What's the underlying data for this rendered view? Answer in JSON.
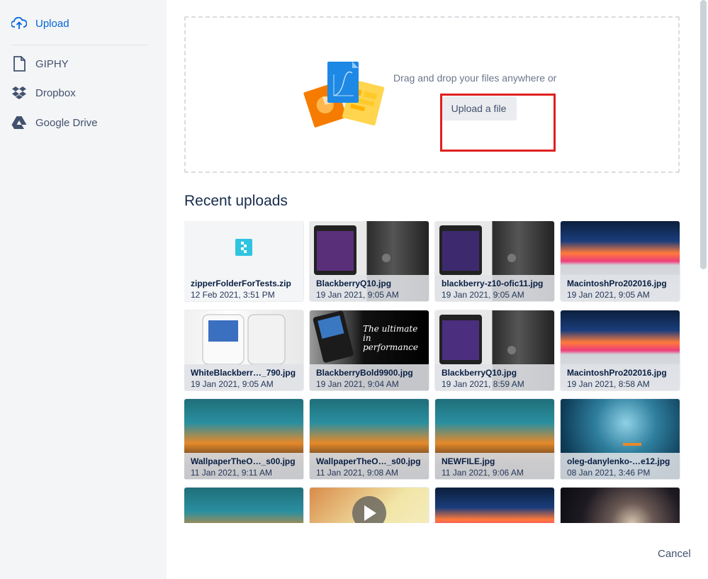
{
  "sidebar": {
    "items": [
      {
        "label": "Upload",
        "icon": "upload-cloud-icon",
        "active": true
      },
      {
        "label": "GIPHY",
        "icon": "file-icon"
      },
      {
        "label": "Dropbox",
        "icon": "dropbox-icon"
      },
      {
        "label": "Google Drive",
        "icon": "google-drive-icon"
      }
    ]
  },
  "dropzone": {
    "text": "Drag and drop your files anywhere or",
    "button_label": "Upload a file"
  },
  "recent": {
    "title": "Recent uploads",
    "items": [
      {
        "name": "zipperFolderForTests.zip",
        "date": "12 Feb 2021, 3:51 PM"
      },
      {
        "name": "BlackberryQ10.jpg",
        "date": "19 Jan 2021, 9:05 AM"
      },
      {
        "name": "blackberry-z10-ofic11.jpg",
        "date": "19 Jan 2021, 9:05 AM"
      },
      {
        "name": "MacintoshPro202016.jpg",
        "date": "19 Jan 2021, 9:05 AM"
      },
      {
        "name": "WhiteBlackberr…_790.jpg",
        "date": "19 Jan 2021, 9:05 AM"
      },
      {
        "name": "BlackberryBold9900.jpg",
        "date": "19 Jan 2021, 9:04 AM"
      },
      {
        "name": "BlackberryQ10.jpg",
        "date": "19 Jan 2021, 8:59 AM"
      },
      {
        "name": "MacintoshPro202016.jpg",
        "date": "19 Jan 2021, 8:58 AM"
      },
      {
        "name": "WallpaperTheO…_s00.jpg",
        "date": "11 Jan 2021, 9:11 AM"
      },
      {
        "name": "WallpaperTheO…_s00.jpg",
        "date": "11 Jan 2021, 9:08 AM"
      },
      {
        "name": "NEWFILE.jpg",
        "date": "11 Jan 2021, 9:06 AM"
      },
      {
        "name": "oleg-danylenko-…e12.jpg",
        "date": "08 Jan 2021, 3:46 PM"
      }
    ],
    "bold_overlay_text": "The ultimate in performance"
  },
  "footer": {
    "cancel_label": "Cancel"
  },
  "colors": {
    "accent": "#0065d9",
    "highlight": "#e02020"
  }
}
